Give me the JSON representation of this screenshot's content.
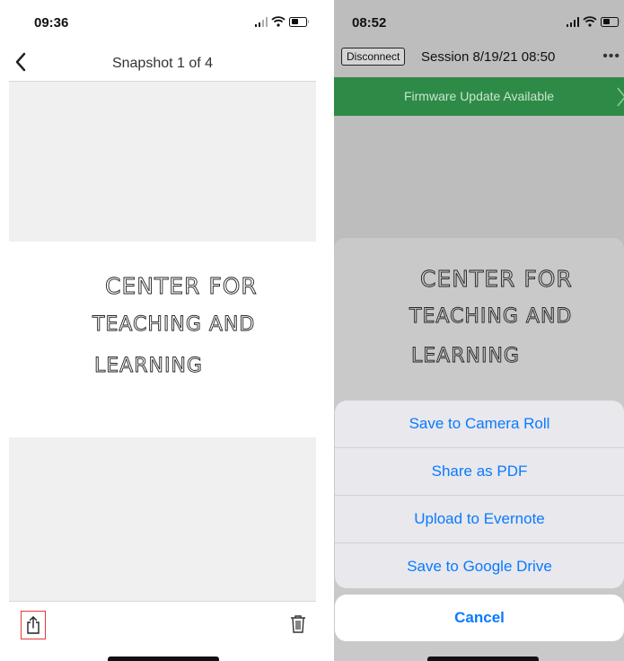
{
  "left_screen": {
    "status": {
      "time": "09:36"
    },
    "nav": {
      "title": "Snapshot 1 of 4"
    },
    "toolbar": {
      "share_icon": "share-icon",
      "trash_icon": "trash-icon"
    }
  },
  "right_screen": {
    "status": {
      "time": "08:52"
    },
    "session": {
      "disconnect_label": "Disconnect",
      "title": "Session 8/19/21 08:50",
      "more": "•••"
    },
    "banner": {
      "text": "Firmware Update Available",
      "color": "#2e8b47"
    },
    "actions": [
      {
        "label": "Save to Camera Roll"
      },
      {
        "label": "Share as PDF"
      },
      {
        "label": "Upload to Evernote"
      },
      {
        "label": "Save to Google Drive"
      }
    ],
    "cancel_label": "Cancel",
    "accent": "#0a7aff"
  },
  "handwriting": [
    "CENTER FOR",
    "TEACHING AND",
    "LEARNING"
  ]
}
